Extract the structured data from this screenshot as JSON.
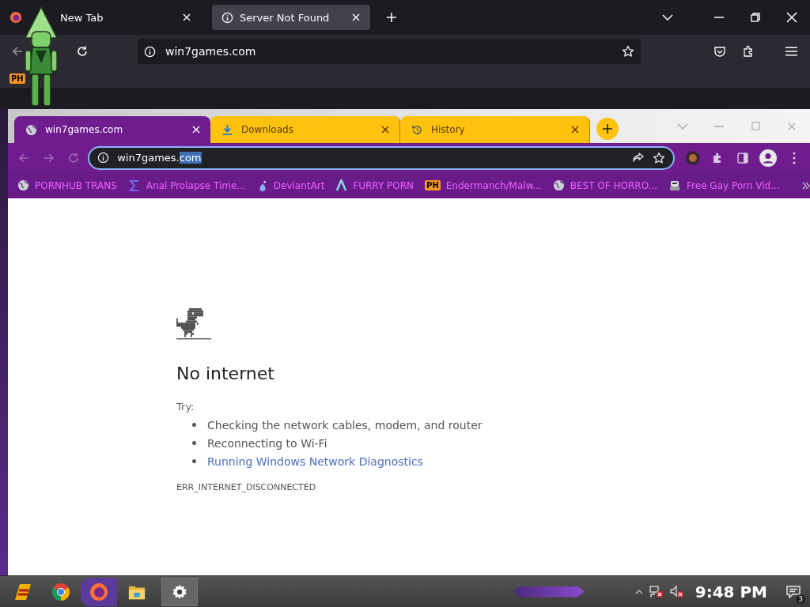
{
  "firefox": {
    "tabs": [
      {
        "title": "New Tab",
        "selected": false
      },
      {
        "title": "Server Not Found",
        "selected": true
      }
    ],
    "url": "win7games.com",
    "bookmarks": [
      {
        "badge": "PH"
      }
    ]
  },
  "chrome": {
    "tabs": [
      {
        "title": "win7games.com",
        "selected": true
      },
      {
        "title": "Downloads",
        "selected": false
      },
      {
        "title": "History",
        "selected": false
      }
    ],
    "address": {
      "text": "win7games.",
      "selected_text": "com"
    },
    "bookmarks": [
      {
        "label": "PORNHUB TRANS"
      },
      {
        "label": "Anal Prolapse Time..."
      },
      {
        "label": "DeviantArt"
      },
      {
        "label": "FURRY PORN"
      },
      {
        "label": "Endermanch/Malw...",
        "badge": "PH"
      },
      {
        "label": "BEST OF HORRO..."
      },
      {
        "label": "Free Gay Porn Vid..."
      }
    ]
  },
  "page": {
    "heading": "No internet",
    "try_label": "Try:",
    "suggestions": [
      {
        "text": "Checking the network cables, modem, and router",
        "kind": "text"
      },
      {
        "text": "Reconnecting to Wi-Fi",
        "kind": "text"
      },
      {
        "text": "Running Windows Network Diagnostics",
        "kind": "link"
      }
    ],
    "error_code": "ERR_INTERNET_DISCONNECTED"
  },
  "taskbar": {
    "apps": [
      {
        "kind": "start"
      },
      {
        "kind": "chrome"
      },
      {
        "kind": "firefox"
      },
      {
        "kind": "files"
      },
      {
        "kind": "settings"
      }
    ],
    "clock": "9:48 PM",
    "notification_count": "3"
  }
}
